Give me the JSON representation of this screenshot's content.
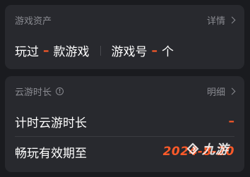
{
  "assets_card": {
    "title": "游戏资产",
    "details_link": "详情",
    "played_prefix": "玩过",
    "played_value": "–",
    "played_suffix": "款游戏",
    "accounts_prefix": "游戏号",
    "accounts_value": "–",
    "accounts_suffix": "个"
  },
  "cloud_card": {
    "title": "云游时长",
    "info_icon_glyph": "!",
    "details_link": "明细",
    "timed_label": "计时云游时长",
    "timed_value": "–",
    "expiry_label": "畅玩有效期至",
    "expiry_value": "2024-8-20"
  },
  "watermark": {
    "text": "九游",
    "icon": "nine-game-logo-icon"
  },
  "colors": {
    "background": "#1a1b1f",
    "card": "#28292e",
    "accent": "#ff5a29",
    "muted_text": "#8a8b91",
    "primary_text": "#ffffff"
  }
}
